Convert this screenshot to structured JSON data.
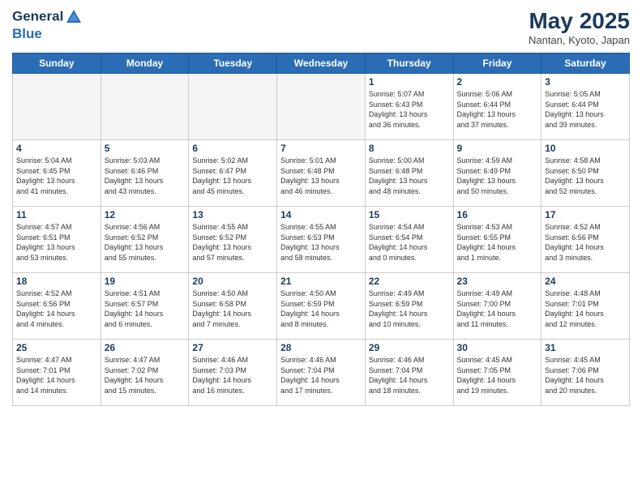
{
  "header": {
    "logo_line1": "General",
    "logo_line2": "Blue",
    "month_title": "May 2025",
    "location": "Nantan, Kyoto, Japan"
  },
  "days_of_week": [
    "Sunday",
    "Monday",
    "Tuesday",
    "Wednesday",
    "Thursday",
    "Friday",
    "Saturday"
  ],
  "weeks": [
    [
      {
        "day": "",
        "info": ""
      },
      {
        "day": "",
        "info": ""
      },
      {
        "day": "",
        "info": ""
      },
      {
        "day": "",
        "info": ""
      },
      {
        "day": "1",
        "info": "Sunrise: 5:07 AM\nSunset: 6:43 PM\nDaylight: 13 hours\nand 36 minutes."
      },
      {
        "day": "2",
        "info": "Sunrise: 5:06 AM\nSunset: 6:44 PM\nDaylight: 13 hours\nand 37 minutes."
      },
      {
        "day": "3",
        "info": "Sunrise: 5:05 AM\nSunset: 6:44 PM\nDaylight: 13 hours\nand 39 minutes."
      }
    ],
    [
      {
        "day": "4",
        "info": "Sunrise: 5:04 AM\nSunset: 6:45 PM\nDaylight: 13 hours\nand 41 minutes."
      },
      {
        "day": "5",
        "info": "Sunrise: 5:03 AM\nSunset: 6:46 PM\nDaylight: 13 hours\nand 43 minutes."
      },
      {
        "day": "6",
        "info": "Sunrise: 5:02 AM\nSunset: 6:47 PM\nDaylight: 13 hours\nand 45 minutes."
      },
      {
        "day": "7",
        "info": "Sunrise: 5:01 AM\nSunset: 6:48 PM\nDaylight: 13 hours\nand 46 minutes."
      },
      {
        "day": "8",
        "info": "Sunrise: 5:00 AM\nSunset: 6:48 PM\nDaylight: 13 hours\nand 48 minutes."
      },
      {
        "day": "9",
        "info": "Sunrise: 4:59 AM\nSunset: 6:49 PM\nDaylight: 13 hours\nand 50 minutes."
      },
      {
        "day": "10",
        "info": "Sunrise: 4:58 AM\nSunset: 6:50 PM\nDaylight: 13 hours\nand 52 minutes."
      }
    ],
    [
      {
        "day": "11",
        "info": "Sunrise: 4:57 AM\nSunset: 6:51 PM\nDaylight: 13 hours\nand 53 minutes."
      },
      {
        "day": "12",
        "info": "Sunrise: 4:56 AM\nSunset: 6:52 PM\nDaylight: 13 hours\nand 55 minutes."
      },
      {
        "day": "13",
        "info": "Sunrise: 4:55 AM\nSunset: 6:52 PM\nDaylight: 13 hours\nand 57 minutes."
      },
      {
        "day": "14",
        "info": "Sunrise: 4:55 AM\nSunset: 6:53 PM\nDaylight: 13 hours\nand 58 minutes."
      },
      {
        "day": "15",
        "info": "Sunrise: 4:54 AM\nSunset: 6:54 PM\nDaylight: 14 hours\nand 0 minutes."
      },
      {
        "day": "16",
        "info": "Sunrise: 4:53 AM\nSunset: 6:55 PM\nDaylight: 14 hours\nand 1 minute."
      },
      {
        "day": "17",
        "info": "Sunrise: 4:52 AM\nSunset: 6:56 PM\nDaylight: 14 hours\nand 3 minutes."
      }
    ],
    [
      {
        "day": "18",
        "info": "Sunrise: 4:52 AM\nSunset: 6:56 PM\nDaylight: 14 hours\nand 4 minutes."
      },
      {
        "day": "19",
        "info": "Sunrise: 4:51 AM\nSunset: 6:57 PM\nDaylight: 14 hours\nand 6 minutes."
      },
      {
        "day": "20",
        "info": "Sunrise: 4:50 AM\nSunset: 6:58 PM\nDaylight: 14 hours\nand 7 minutes."
      },
      {
        "day": "21",
        "info": "Sunrise: 4:50 AM\nSunset: 6:59 PM\nDaylight: 14 hours\nand 8 minutes."
      },
      {
        "day": "22",
        "info": "Sunrise: 4:49 AM\nSunset: 6:59 PM\nDaylight: 14 hours\nand 10 minutes."
      },
      {
        "day": "23",
        "info": "Sunrise: 4:49 AM\nSunset: 7:00 PM\nDaylight: 14 hours\nand 11 minutes."
      },
      {
        "day": "24",
        "info": "Sunrise: 4:48 AM\nSunset: 7:01 PM\nDaylight: 14 hours\nand 12 minutes."
      }
    ],
    [
      {
        "day": "25",
        "info": "Sunrise: 4:47 AM\nSunset: 7:01 PM\nDaylight: 14 hours\nand 14 minutes."
      },
      {
        "day": "26",
        "info": "Sunrise: 4:47 AM\nSunset: 7:02 PM\nDaylight: 14 hours\nand 15 minutes."
      },
      {
        "day": "27",
        "info": "Sunrise: 4:46 AM\nSunset: 7:03 PM\nDaylight: 14 hours\nand 16 minutes."
      },
      {
        "day": "28",
        "info": "Sunrise: 4:46 AM\nSunset: 7:04 PM\nDaylight: 14 hours\nand 17 minutes."
      },
      {
        "day": "29",
        "info": "Sunrise: 4:46 AM\nSunset: 7:04 PM\nDaylight: 14 hours\nand 18 minutes."
      },
      {
        "day": "30",
        "info": "Sunrise: 4:45 AM\nSunset: 7:05 PM\nDaylight: 14 hours\nand 19 minutes."
      },
      {
        "day": "31",
        "info": "Sunrise: 4:45 AM\nSunset: 7:06 PM\nDaylight: 14 hours\nand 20 minutes."
      }
    ]
  ]
}
